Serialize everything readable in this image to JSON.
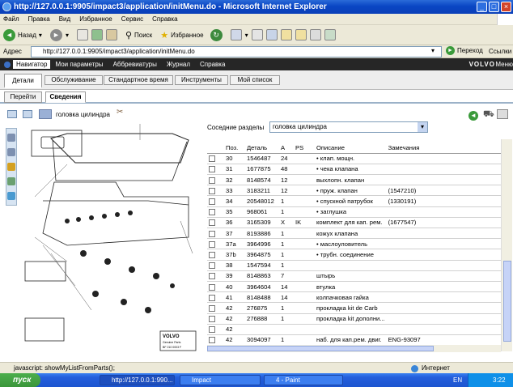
{
  "window": {
    "title": "http://127.0.0.1:9905/impact3/application/initMenu.do - Microsoft Internet Explorer"
  },
  "ie_menu": [
    "Файл",
    "Правка",
    "Вид",
    "Избранное",
    "Сервис",
    "Справка"
  ],
  "toolbar": {
    "back": "Назад",
    "search": "Поиск",
    "favorites": "Избранное"
  },
  "address": {
    "label": "Адрес",
    "url": "http://127.0.0.1:9905/impact3/application/initMenu.do",
    "go": "Переход",
    "links": "Ссылки"
  },
  "app_nav": {
    "items": [
      "Навигатор",
      "Мои параметры",
      "Аббревиатуры",
      "Журнал",
      "Справка"
    ],
    "brand": "VOLVO",
    "menu": "Меню"
  },
  "main_tabs": [
    "Детали",
    "Обслуживание",
    "Стандартное время",
    "Инструменты",
    "Мой список"
  ],
  "sub_tabs": [
    "Перейти",
    "Сведения"
  ],
  "part_title": "головка цилиндра",
  "neighbors": {
    "label": "Соседние разделы",
    "value": "головка цилиндра"
  },
  "table": {
    "headers": [
      "Поз.",
      "Деталь",
      "A",
      "PS",
      "Описание",
      "Замечания"
    ],
    "rows": [
      [
        "30",
        "1546487",
        "24",
        "",
        "• клап. мощн.",
        ""
      ],
      [
        "31",
        "1677875",
        "48",
        "",
        "• чека клапана",
        ""
      ],
      [
        "32",
        "8148574",
        "12",
        "",
        "выхлопн. клапан",
        ""
      ],
      [
        "33",
        "3183211",
        "12",
        "",
        "• пруж. клапан",
        "(1547210)"
      ],
      [
        "34",
        "20548012",
        "1",
        "",
        "• спускной патрубок",
        "(1330191)"
      ],
      [
        "35",
        "968061",
        "1",
        "",
        "• заглушка",
        ""
      ],
      [
        "36",
        "3165309",
        "X",
        "IK",
        "комплект для кап. рем.",
        "(1677547)"
      ],
      [
        "37",
        "8193886",
        "1",
        "",
        "кожух клапана",
        ""
      ],
      [
        "37a",
        "3964996",
        "1",
        "",
        "• маслоуловитель",
        ""
      ],
      [
        "37b",
        "3964875",
        "1",
        "",
        "• трубн. соединение",
        ""
      ],
      [
        "38",
        "1547594",
        "1",
        "",
        "",
        ""
      ],
      [
        "39",
        "8148863",
        "7",
        "",
        "штырь",
        ""
      ],
      [
        "40",
        "3964604",
        "14",
        "",
        "втулка",
        ""
      ],
      [
        "41",
        "8148488",
        "14",
        "",
        "колпачковая гайка",
        ""
      ],
      [
        "42",
        "276875",
        "1",
        "",
        "прокладка kit de Carb",
        ""
      ],
      [
        "42",
        "276888",
        "1",
        "",
        "прокладка kit дополни...",
        ""
      ],
      [
        "42",
        "",
        "",
        "",
        "",
        ""
      ],
      [
        "42",
        "3094097",
        "1",
        "",
        "наб. для кап.рем. двиг.",
        "ENG-93097"
      ]
    ]
  },
  "diagram": {
    "brand": "VOLVO",
    "caption1": "Genuine Parts",
    "caption2": "BF 210 0003 F"
  },
  "status": {
    "text": "javascript: showMyListFromParts();",
    "zone": "Интернет"
  },
  "taskbar": {
    "start": "пуск",
    "tasks": [
      "http://127.0.0.1:990...",
      "Impact",
      "4 - Paint"
    ],
    "lang": "EN",
    "clock": "3:22"
  },
  "colors": {
    "title_blue": "#0a46c4",
    "nav_dark": "#262626",
    "tab_border": "#9cb2c8"
  }
}
